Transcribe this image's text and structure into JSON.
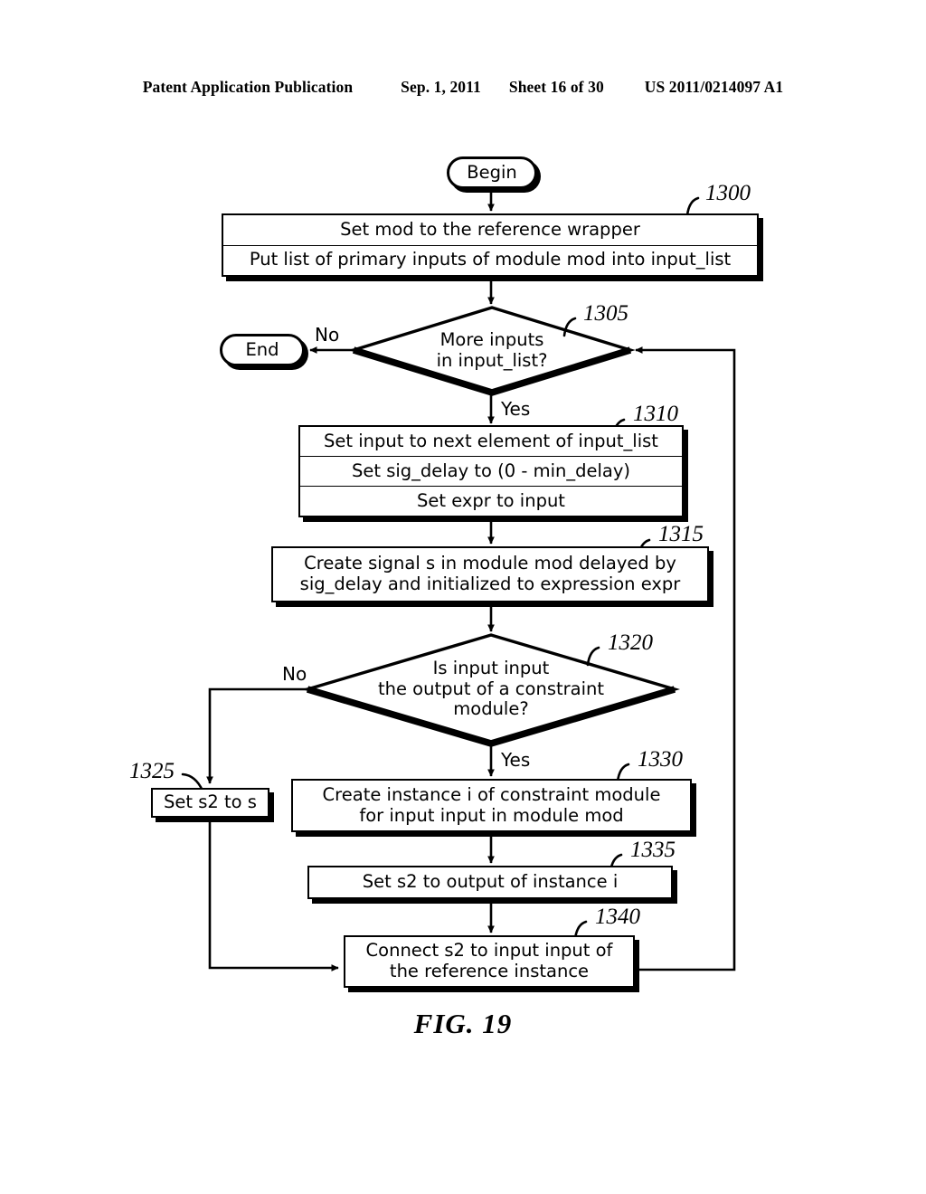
{
  "header": {
    "publication": "Patent Application Publication",
    "date": "Sep. 1, 2011",
    "sheet": "Sheet 16 of 30",
    "number": "US 2011/0214097 A1"
  },
  "figure": {
    "caption": "FIG. 19"
  },
  "nodes": {
    "begin": {
      "label": "Begin",
      "type": "terminator"
    },
    "end": {
      "label": "End",
      "type": "terminator"
    },
    "n1300": {
      "ref": "1300",
      "type": "process",
      "rows": [
        "Set mod to the reference wrapper",
        "Put list of primary inputs of module mod into input_list"
      ]
    },
    "n1305": {
      "ref": "1305",
      "type": "decision",
      "lines": [
        "More inputs",
        "in input_list?"
      ]
    },
    "n1310": {
      "ref": "1310",
      "type": "process",
      "rows": [
        "Set input to next element of input_list",
        "Set sig_delay to (0 - min_delay)",
        "Set expr to input"
      ]
    },
    "n1315": {
      "ref": "1315",
      "type": "process",
      "rows": [
        "Create signal s in module mod delayed by\nsig_delay and initialized to expression expr"
      ]
    },
    "n1320": {
      "ref": "1320",
      "type": "decision",
      "lines": [
        "Is input input",
        "the output of a constraint",
        "module?"
      ]
    },
    "n1325": {
      "ref": "1325",
      "type": "process",
      "rows": [
        "Set s2 to s"
      ]
    },
    "n1330": {
      "ref": "1330",
      "type": "process",
      "rows": [
        "Create instance i of constraint module\nfor input input in module mod"
      ]
    },
    "n1335": {
      "ref": "1335",
      "type": "process",
      "rows": [
        "Set s2 to output of instance i"
      ]
    },
    "n1340": {
      "ref": "1340",
      "type": "process",
      "rows": [
        "Connect s2 to input input of\nthe reference instance"
      ]
    }
  },
  "edge_labels": {
    "d1305_no": "No",
    "d1305_yes": "Yes",
    "d1320_no": "No",
    "d1320_yes": "Yes"
  },
  "colors": {
    "ink": "#000000",
    "paper": "#ffffff"
  }
}
